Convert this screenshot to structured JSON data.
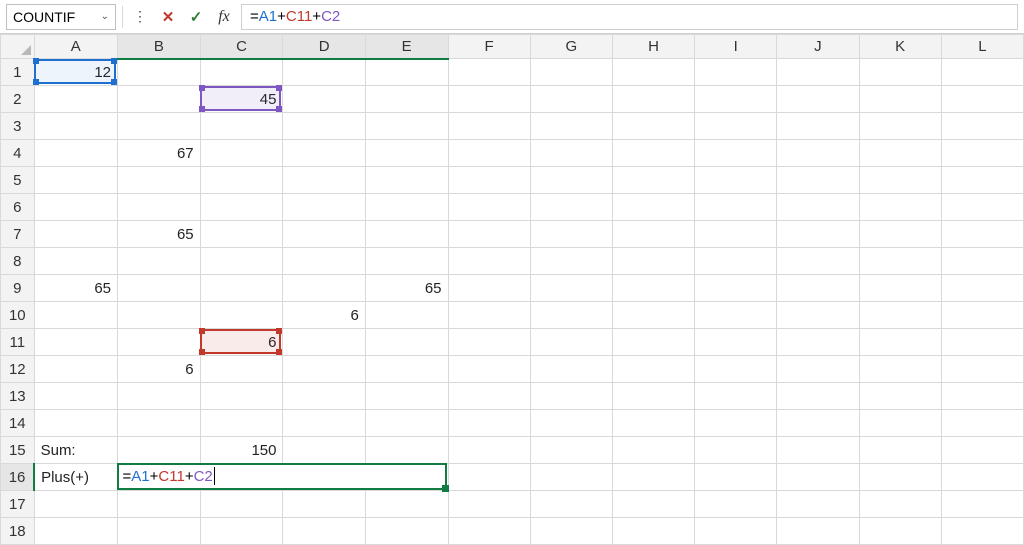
{
  "colors": {
    "accent_green": "#107c41",
    "ref_blue": "#1f6fd0",
    "ref_purple": "#7e57c2",
    "ref_red": "#c0392b"
  },
  "formula_bar": {
    "name_box": "COUNTIF",
    "cancel_icon": "✕",
    "enter_icon": "✓",
    "fx_icon": "fx",
    "dots_icon": "⋮",
    "chevron_icon": "⌄",
    "formula_prefix": "=",
    "ref1": "A1",
    "op1": "+",
    "ref2": "C11",
    "op2": "+",
    "ref3": "C2"
  },
  "columns": [
    "A",
    "B",
    "C",
    "D",
    "E",
    "F",
    "G",
    "H",
    "I",
    "J",
    "K",
    "L"
  ],
  "rows": [
    "1",
    "2",
    "3",
    "4",
    "5",
    "6",
    "7",
    "8",
    "9",
    "10",
    "11",
    "12",
    "13",
    "14",
    "15",
    "16",
    "17",
    "18"
  ],
  "active": {
    "row": "16",
    "cols": [
      "B",
      "C",
      "D",
      "E"
    ]
  },
  "cells": {
    "A1": "12",
    "C2": "45",
    "B4": "67",
    "B7": "65",
    "A9": "65",
    "E9": "65",
    "D10": "6",
    "C11": "6",
    "B12": "6",
    "A15": "Sum:",
    "C15": "150",
    "A16": "Plus(+)"
  },
  "editing": {
    "prefix": "=",
    "ref1": "A1",
    "op1": "+",
    "ref2": "C11",
    "op2": "+",
    "ref3": "C2"
  },
  "ref_highlights": [
    {
      "cell": "A1",
      "color": "blue"
    },
    {
      "cell": "C2",
      "color": "purple"
    },
    {
      "cell": "C11",
      "color": "red"
    }
  ]
}
